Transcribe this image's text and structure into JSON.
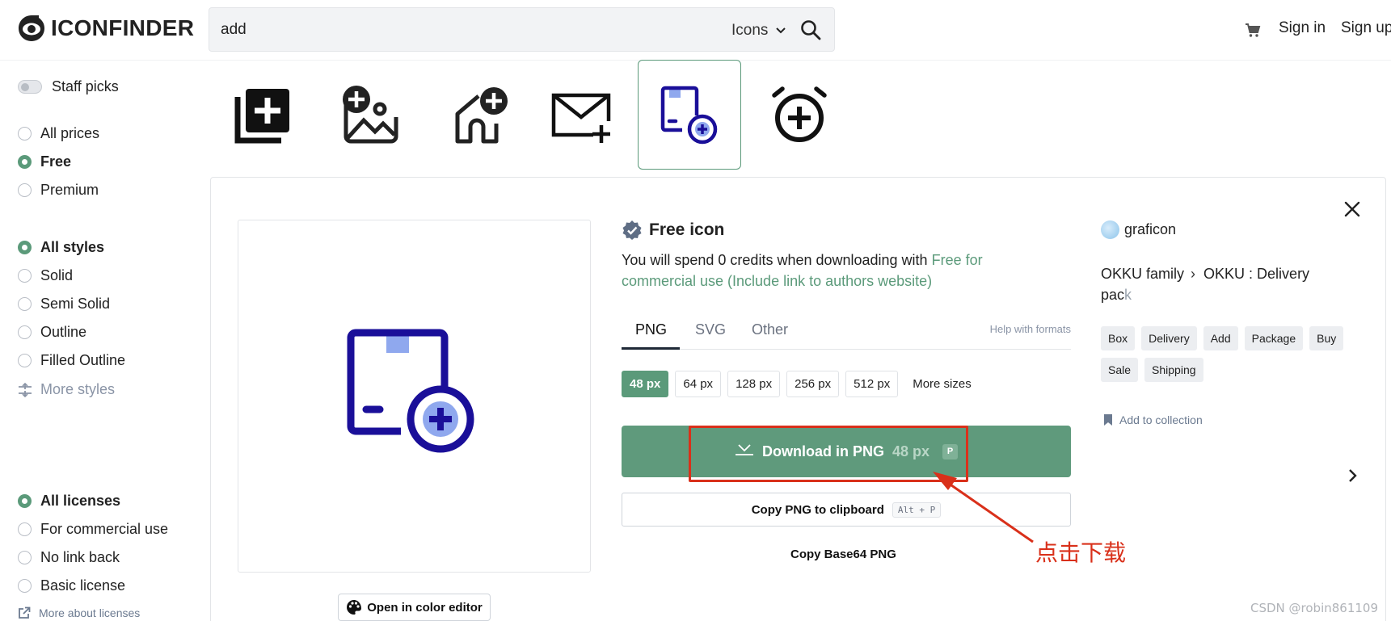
{
  "header": {
    "logo_text": "ICONFINDER",
    "search_value": "add",
    "search_type": "Icons",
    "sign_in": "Sign in",
    "sign_up": "Sign up"
  },
  "sidebar": {
    "staff_picks": "Staff picks",
    "prices": [
      "All prices",
      "Free",
      "Premium"
    ],
    "styles": [
      "All styles",
      "Solid",
      "Semi Solid",
      "Outline",
      "Filled Outline"
    ],
    "more_styles": "More styles",
    "licenses": [
      "All licenses",
      "For commercial use",
      "No link back",
      "Basic license"
    ],
    "more_licenses": "More about licenses"
  },
  "icon_strip": [
    "add-photo-icon",
    "add-image-icon",
    "add-home-icon",
    "add-mail-icon",
    "add-package-icon",
    "add-alarm-icon"
  ],
  "detail": {
    "free_title": "Free icon",
    "desc_text": "You will spend 0 credits when downloading with ",
    "desc_link": "Free for commercial use (Include link to authors website)",
    "tabs": [
      "PNG",
      "SVG",
      "Other"
    ],
    "help_formats": "Help with formats",
    "sizes": [
      "48 px",
      "64 px",
      "128 px",
      "256 px",
      "512 px"
    ],
    "more_sizes": "More sizes",
    "download_label": "Download in PNG",
    "download_size": "48 px",
    "download_kbd": "P",
    "copy_label": "Copy PNG to clipboard",
    "copy_kbd": "Alt + P",
    "copy_base64": "Copy Base64 PNG",
    "color_editor": "Open in color editor",
    "author": "graficon",
    "crumb_family": "OKKU family",
    "crumb_pack_a": "OKKU : Delivery",
    "crumb_pack_b": "pac",
    "crumb_pack_c": "k",
    "tags": [
      "Box",
      "Delivery",
      "Add",
      "Package",
      "Buy",
      "Sale",
      "Shipping"
    ],
    "add_collection": "Add to collection"
  },
  "annotation": "点击下载",
  "watermark": "CSDN @robin861109",
  "colors": {
    "accent": "#5f9a7c",
    "icon_navy": "#1a0f99",
    "icon_light": "#8fa8ee",
    "annotation_red": "#d9301a"
  }
}
